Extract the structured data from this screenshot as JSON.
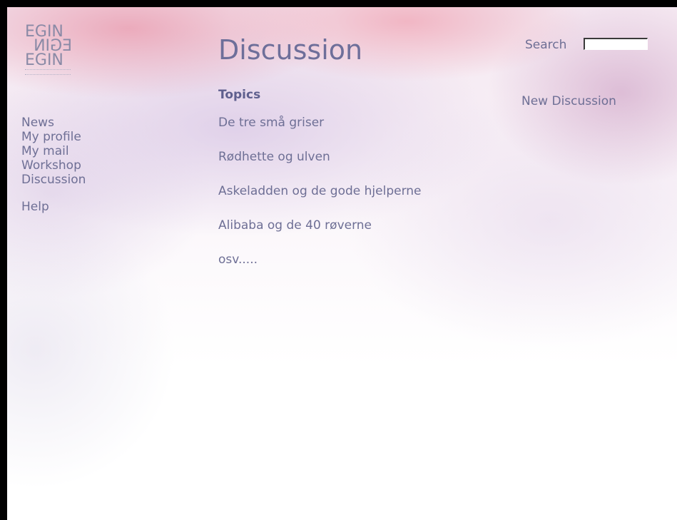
{
  "logo": {
    "line1": "EGIN",
    "line2": "EGIN",
    "line3": "EGIN"
  },
  "sidebar": {
    "items": [
      {
        "label": "News"
      },
      {
        "label": "My profile"
      },
      {
        "label": "My mail"
      },
      {
        "label": "Workshop"
      },
      {
        "label": "Discussion"
      }
    ],
    "help": "Help"
  },
  "page": {
    "title": "Discussion"
  },
  "search": {
    "label": "Search",
    "value": ""
  },
  "topics": {
    "heading": "Topics",
    "items": [
      "De tre små griser",
      "Rødhette og ulven",
      "Askeladden og de gode hjelperne",
      "Alibaba og de 40 røverne",
      "osv....."
    ]
  },
  "actions": {
    "new_discussion": "New Discussion"
  },
  "colors": {
    "text": "#6e6f95",
    "heading": "#5f5f8e",
    "border": "#000000"
  }
}
